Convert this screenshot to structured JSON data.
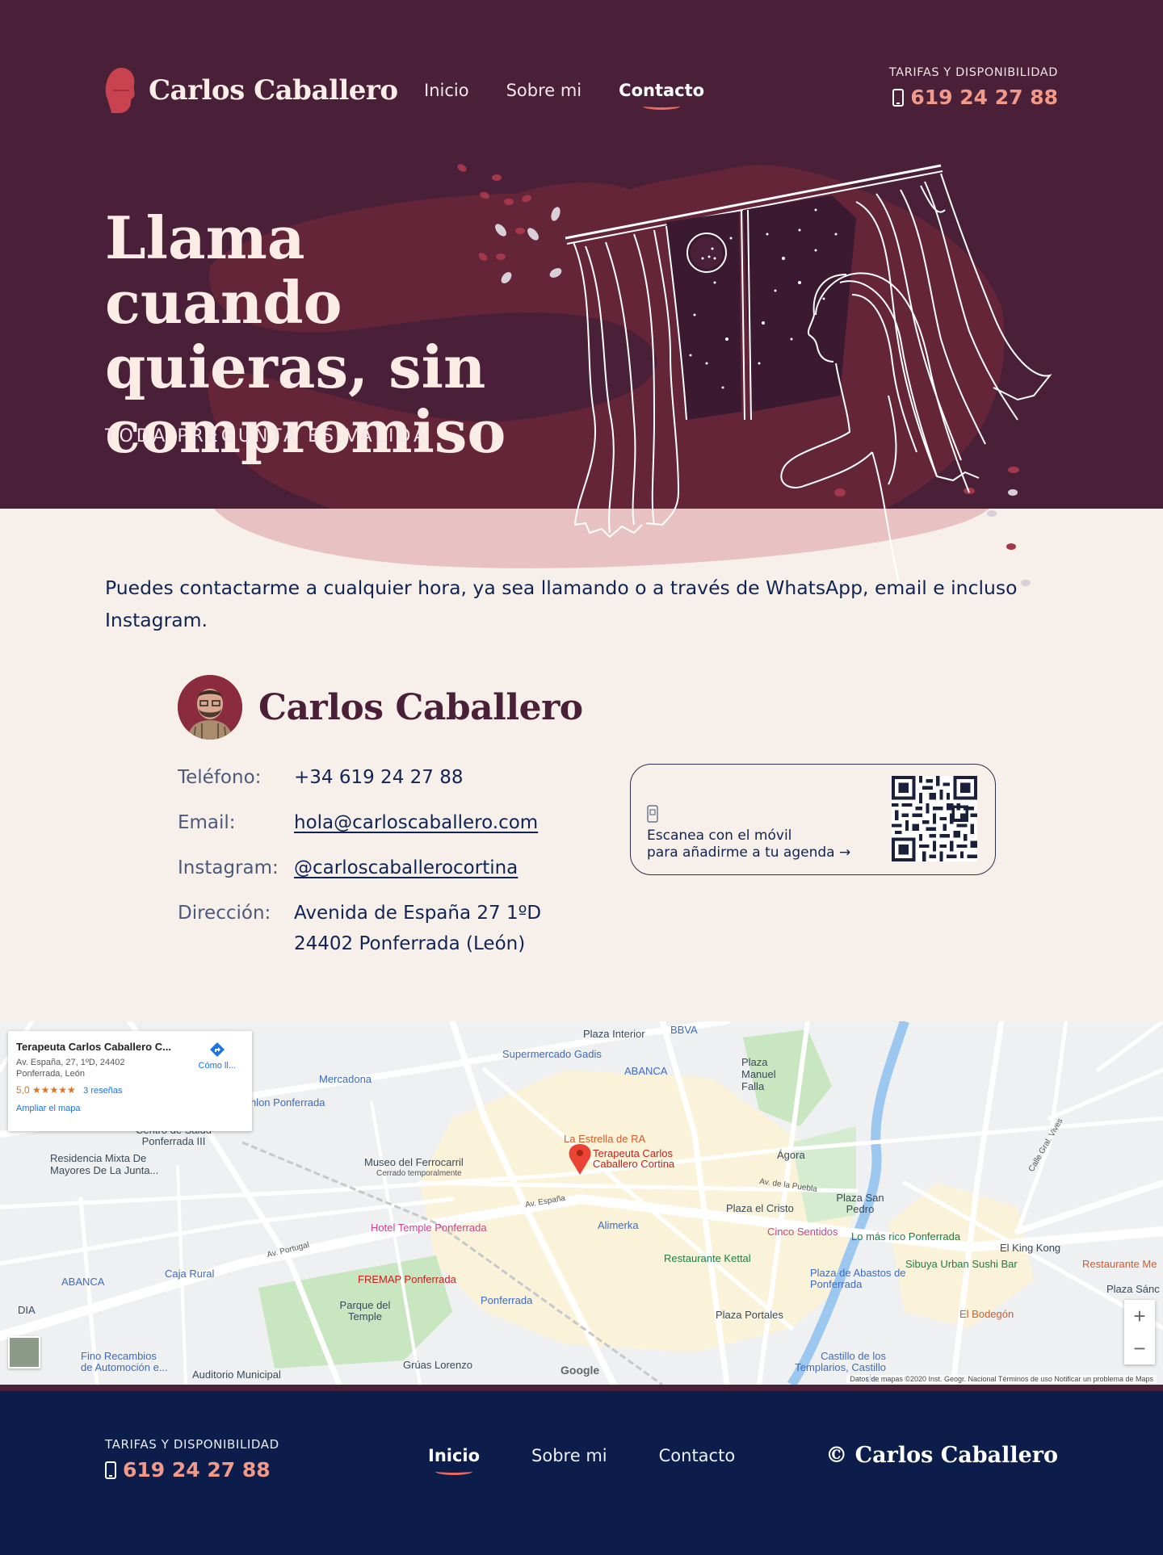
{
  "brand": {
    "name": "Carlos Caballero"
  },
  "nav": {
    "items": [
      {
        "label": "Inicio"
      },
      {
        "label": "Sobre mi"
      },
      {
        "label": "Contacto"
      }
    ]
  },
  "header_contact": {
    "caption": "TARIFAS Y DISPONIBILIDAD",
    "phone": "619 24 27 88"
  },
  "hero": {
    "title": "Llama cuando quieras, sin compromiso",
    "subtitle": "TODA PREGUNTA ES VÁLIDA"
  },
  "intro": "Puedes contactarme a cualquier hora, ya sea llamando o a través de WhatsApp, email e incluso Instagram.",
  "card": {
    "name": "Carlos Caballero",
    "rows": [
      {
        "label": "Teléfono:",
        "value": "+34 619 24 27 88"
      },
      {
        "label": "Email:",
        "value": "hola@carloscaballero.com"
      },
      {
        "label": "Instagram:",
        "value": "@carloscaballerocortina"
      },
      {
        "label": "Dirección:",
        "value": "Avenida de España 27 1ºD",
        "value2": "24402 Ponferrada (León)"
      }
    ],
    "qr": {
      "line1": "Escanea con el móvil",
      "line2": "para añadirme a tu agenda →"
    }
  },
  "map": {
    "card": {
      "title": "Terapeuta Carlos Caballero C...",
      "address": "Av. España, 27, 1ºD, 24402 Ponferrada, León",
      "rating": "5,0 ★★★★★",
      "reviews": "3 reseñas",
      "link": "Ampliar el mapa",
      "directions": "Cómo ll..."
    },
    "attribution": "Datos de mapas ©2020 Inst. Geogr. Nacional   Términos de uso   Notificar un problema de Maps",
    "google": "Google",
    "zoom_in": "+",
    "zoom_out": "−",
    "labels": [
      "Plaza Interior",
      "BBVA",
      "Supermercado Gadis",
      "ABANCA",
      "Plaza Manuel Falla",
      "Mercadona",
      "Decathlon Ponferrada",
      "Centro de Salud Ponferrada III",
      "Residencia Mixta De Mayores De La Junta...",
      "Museo del Ferrocarril",
      "Cerrado temporalmente",
      "La Estrella de RA",
      "Ágora",
      "Terapeuta Carlos Caballero Cortina",
      "Plaza el Cristo",
      "Plaza San Pedro",
      "Hotel Temple Ponferrada",
      "Alimerka",
      "Cinco Sentidos",
      "Lo más rico Ponferrada",
      "El King Kong",
      "Sibuya Urban Sushi Bar",
      "Restaurante Me",
      "Restaurante Kettal",
      "Caja Rural",
      "ABANCA",
      "FREMAP Ponferrada",
      "Parque del Temple",
      "Ponferrada",
      "Plaza de Abastos de Ponferrada",
      "Plaza Portales",
      "El Bodegón",
      "Plaza Sánc",
      "Fino Recambios de Automoción e...",
      "Auditorio Municipal",
      "Grúas Lorenzo",
      "Castillo de los Templarios, Castillo de...",
      "DIA",
      "Av. Portugal",
      "Av. España",
      "Av. de la Puebla",
      "Calle Gral. Vives"
    ]
  },
  "footer": {
    "caption": "TARIFAS Y DISPONIBILIDAD",
    "phone": "619 24 27 88",
    "nav": [
      {
        "label": "Inicio"
      },
      {
        "label": "Sobre mi"
      },
      {
        "label": "Contacto"
      }
    ],
    "copyright": "© Carlos Caballero"
  },
  "colors": {
    "hero_bg": "#4a1f38",
    "accent": "#f29a8a",
    "page_bg": "#f7f0ea",
    "footer_bg": "#0c1d4b",
    "text_dark": "#102453"
  }
}
